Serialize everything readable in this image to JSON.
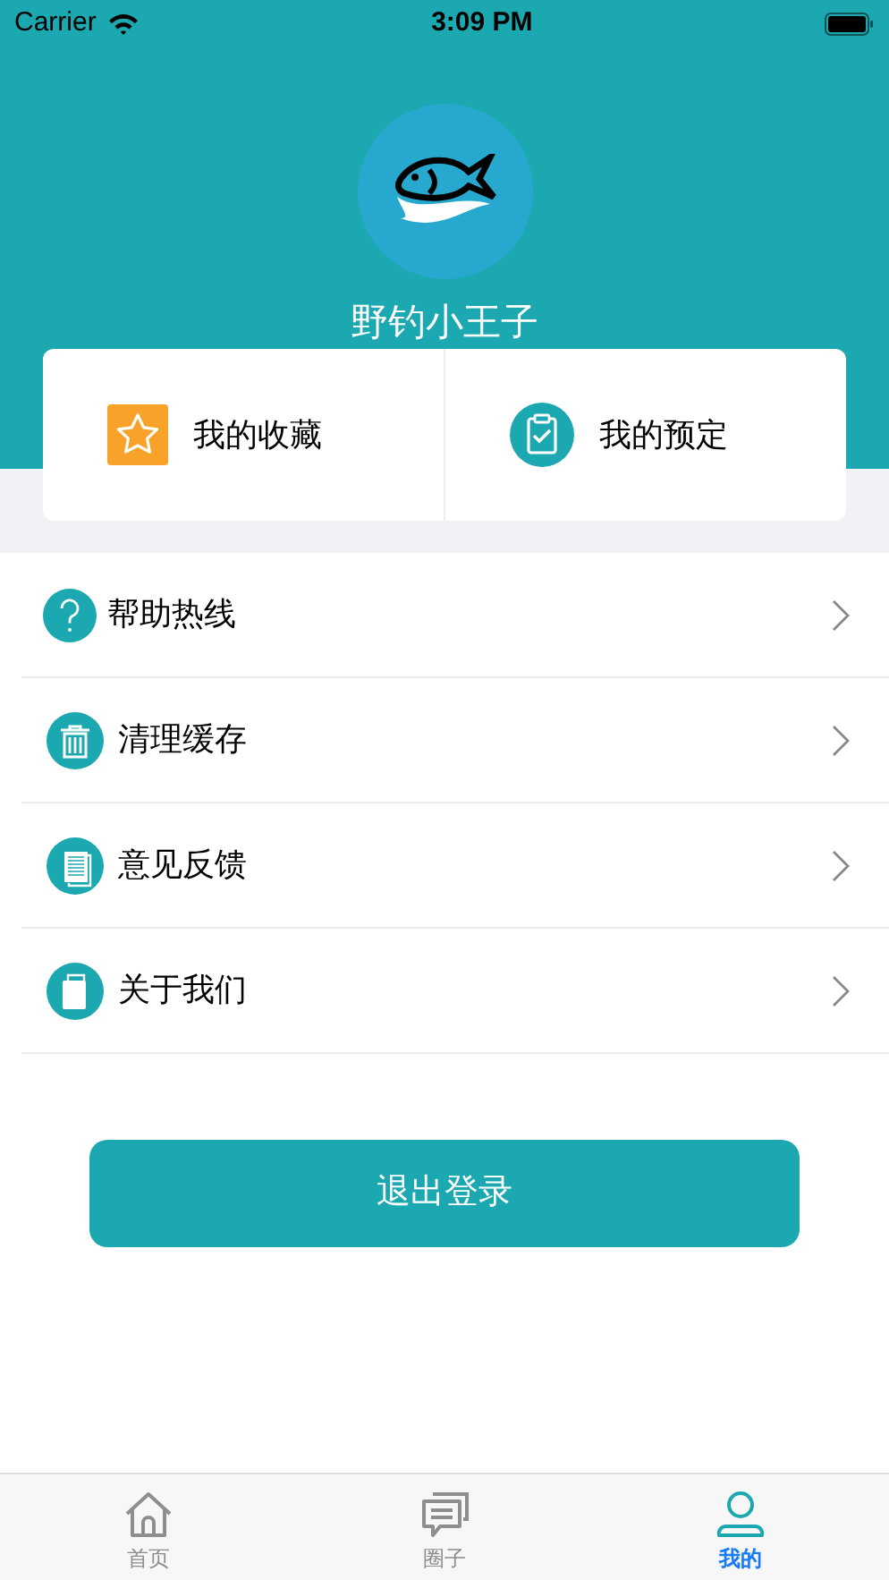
{
  "status_bar": {
    "carrier": "Carrier",
    "time": "3:09 PM"
  },
  "profile": {
    "username": "野钓小王子"
  },
  "shortcuts": [
    {
      "kind": "favorites",
      "label": "我的收藏"
    },
    {
      "kind": "bookings",
      "label": "我的预定"
    }
  ],
  "menu": [
    {
      "kind": "help",
      "label": "帮助热线"
    },
    {
      "kind": "trash",
      "label": "清理缓存"
    },
    {
      "kind": "feedback",
      "label": "意见反馈"
    },
    {
      "kind": "about",
      "label": "关于我们"
    }
  ],
  "logout_button": "退出登录",
  "tab_bar": [
    {
      "kind": "home",
      "label": "首页",
      "selected": false
    },
    {
      "kind": "chat",
      "label": "圈子",
      "selected": false
    },
    {
      "kind": "user",
      "label": "我的",
      "selected": true
    }
  ]
}
